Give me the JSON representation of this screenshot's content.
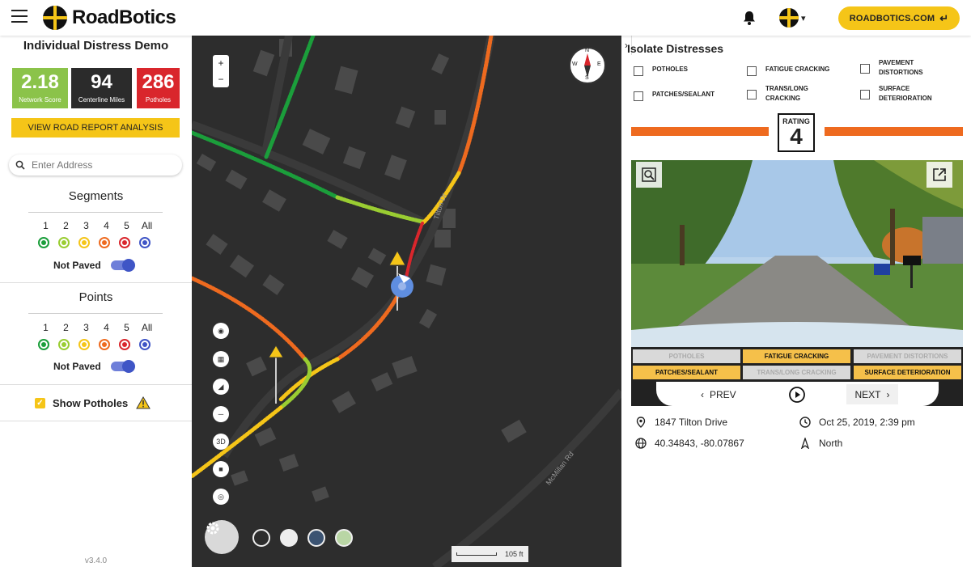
{
  "header": {
    "logo_text": "RoadBotics",
    "site_button_label": "ROADBOTICS.COM"
  },
  "left": {
    "project_title": "Individual Distress Demo",
    "stats": [
      {
        "value": "2.18",
        "label": "Network Score",
        "color": "#8bc34a"
      },
      {
        "value": "94",
        "label": "Centerline Miles",
        "color": "#2b2b2b"
      },
      {
        "value": "286",
        "label": "Potholes",
        "color": "#d9262c"
      }
    ],
    "report_button": "VIEW ROAD REPORT ANALYSIS",
    "search_placeholder": "Enter Address",
    "segments_title": "Segments",
    "points_title": "Points",
    "levels": [
      "1",
      "2",
      "3",
      "4",
      "5",
      "All"
    ],
    "level_colors": [
      "#1b9e3b",
      "#9acd32",
      "#f5c518",
      "#ee6a1f",
      "#d9262c",
      "#3f55c6"
    ],
    "not_paved_label": "Not Paved",
    "show_potholes_label": "Show Potholes",
    "version": "v3.4.0"
  },
  "map": {
    "zoom_in": "+",
    "zoom_out": "−",
    "road_labels": [
      "Tilton Dr",
      "McMillan Rd"
    ],
    "compass": {
      "n": "N",
      "s": "S",
      "e": "E",
      "w": "W"
    },
    "tool_3d": "3D",
    "scale_text": "105 ft"
  },
  "right": {
    "isolate_title": "Isolate Distresses",
    "isolate_options": [
      {
        "line1": "POTHOLES",
        "line2": ""
      },
      {
        "line1": "FATIGUE CRACKING",
        "line2": ""
      },
      {
        "line1": "PAVEMENT",
        "line2": "DISTORTIONS"
      },
      {
        "line1": "PATCHES/SEALANT",
        "line2": ""
      },
      {
        "line1": "TRANS/LONG",
        "line2": "CRACKING"
      },
      {
        "line1": "SURFACE",
        "line2": "DETERIORATION"
      }
    ],
    "rating_label": "RATING",
    "rating_value": "4",
    "tags": [
      {
        "label": "POTHOLES",
        "active": false
      },
      {
        "label": "FATIGUE CRACKING",
        "active": true
      },
      {
        "label": "PAVEMENT DISTORTIONS",
        "active": false
      },
      {
        "label": "PATCHES/SEALANT",
        "active": true
      },
      {
        "label": "TRANS/LONG CRACKING",
        "active": false
      },
      {
        "label": "SURFACE DETERIORATION",
        "active": true
      }
    ],
    "prev_label": "PREV",
    "next_label": "NEXT",
    "address": "1847 Tilton Drive",
    "datetime": "Oct 25, 2019, 2:39 pm",
    "coords": "40.34843, -80.07867",
    "direction": "North",
    "accent_color": "#ee6a1f"
  }
}
